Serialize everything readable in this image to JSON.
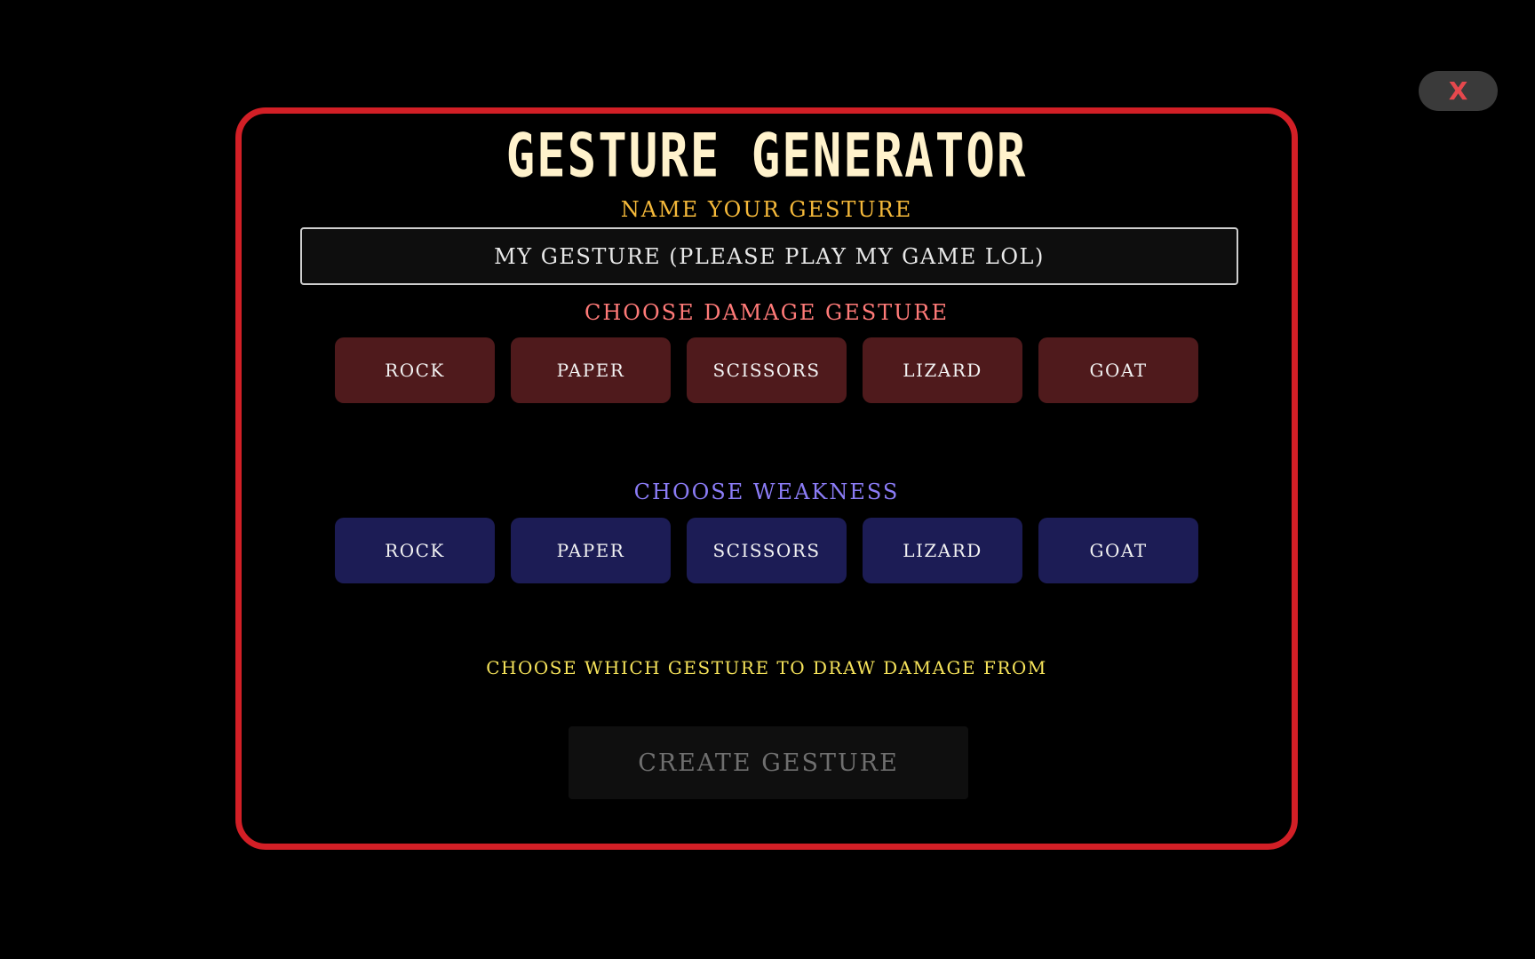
{
  "close": {
    "label": "X"
  },
  "modal": {
    "title": "GESTURE GENERATOR",
    "name_label": "NAME YOUR GESTURE",
    "name_input": {
      "value": "MY GESTURE (PLEASE PLAY MY GAME LOL)"
    },
    "damage_label": "CHOOSE DAMAGE GESTURE",
    "damage_options": [
      "ROCK",
      "PAPER",
      "SCISSORS",
      "LIZARD",
      "GOAT"
    ],
    "weakness_label": "CHOOSE WEAKNESS",
    "weakness_options": [
      "ROCK",
      "PAPER",
      "SCISSORS",
      "LIZARD",
      "GOAT"
    ],
    "draw_label": "CHOOSE WHICH GESTURE TO DRAW DAMAGE FROM",
    "create_label": "CREATE GESTURE"
  },
  "colors": {
    "modal_border": "#d21f26",
    "close_x": "#e5484d",
    "name_label": "#f5b93a",
    "damage_label": "#ff7a78",
    "weakness_label": "#8b7cf6",
    "draw_label": "#f6e35a",
    "damage_button": "#4f1a1c",
    "weakness_button": "#1c1c55"
  }
}
